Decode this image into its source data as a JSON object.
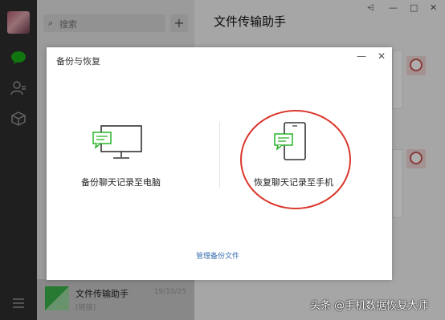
{
  "search": {
    "placeholder": "搜索"
  },
  "list": {
    "items": [
      {
        "name": "文件传输助手",
        "date": "19/10/25",
        "preview": "[链接]"
      }
    ]
  },
  "chat": {
    "title": "文件传输助手"
  },
  "window_controls": {
    "pin": "⩤",
    "minimize": "—",
    "maximize": "□",
    "close": "✕"
  },
  "dialog": {
    "title": "备份与恢复",
    "minimize": "—",
    "close": "✕",
    "backup_to_pc_label": "备份聊天记录至电脑",
    "restore_to_phone_label": "恢复聊天记录至手机",
    "manage_backup_link": "管理备份文件"
  },
  "watermark": "头条 @手机数据恢复大师",
  "colors": {
    "nav_bg": "#2e2e2e",
    "accent_green": "#1aad19",
    "annotation_red": "#d9362b",
    "link_blue": "#3a6fb0"
  }
}
